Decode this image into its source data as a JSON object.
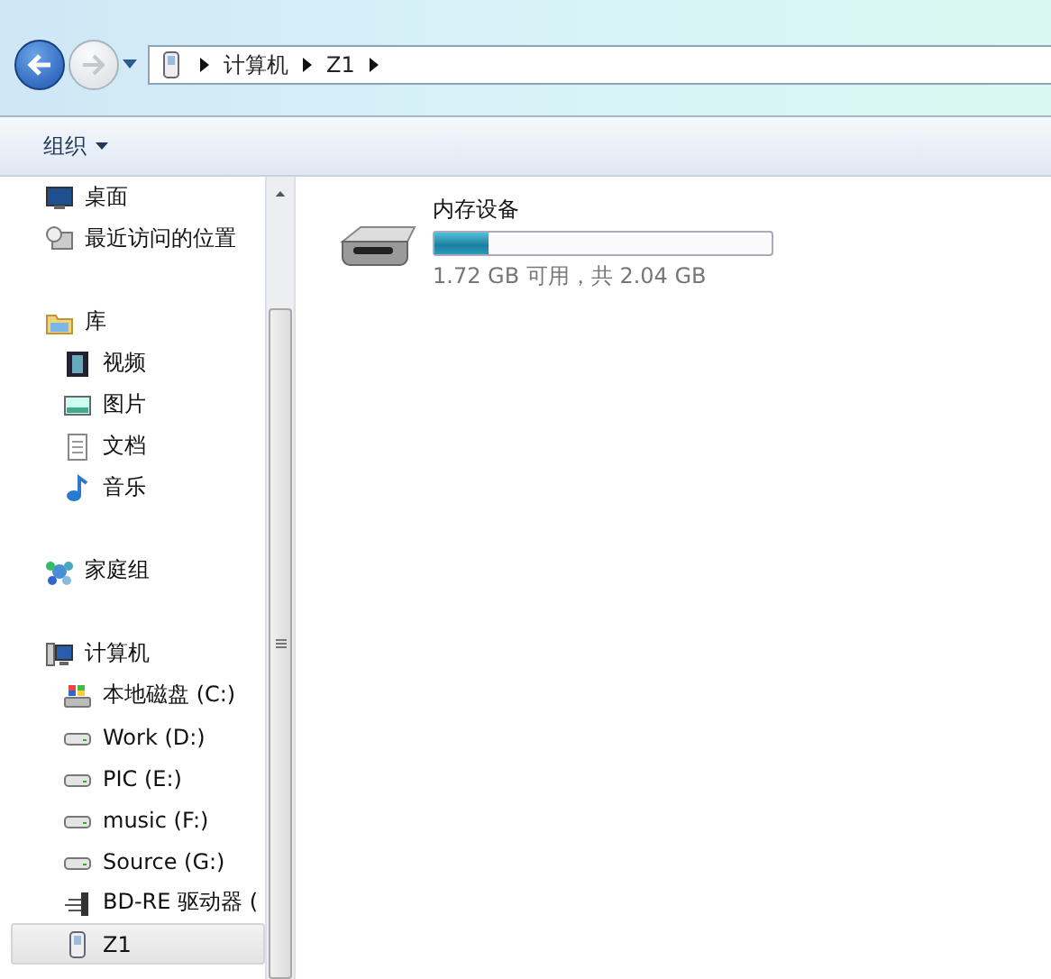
{
  "address_bar": {
    "crumbs": [
      "计算机",
      "Z1"
    ]
  },
  "toolbar": {
    "organize": "组织"
  },
  "nav_pane": {
    "groups": [
      {
        "kind": "favorites",
        "items": [
          {
            "kind": "desktop",
            "label": "桌面",
            "selected": false
          },
          {
            "kind": "recent",
            "label": "最近访问的位置",
            "selected": false
          }
        ]
      },
      {
        "kind": "libraries",
        "label": "库",
        "items": [
          {
            "kind": "video",
            "label": "视频",
            "selected": false
          },
          {
            "kind": "pictures",
            "label": "图片",
            "selected": false
          },
          {
            "kind": "documents",
            "label": "文档",
            "selected": false
          },
          {
            "kind": "music",
            "label": "音乐",
            "selected": false
          }
        ]
      },
      {
        "kind": "homegroup",
        "label": "家庭组"
      },
      {
        "kind": "computer",
        "label": "计算机",
        "items": [
          {
            "kind": "system-drive",
            "label": "本地磁盘 (C:)",
            "selected": false
          },
          {
            "kind": "drive",
            "label": "Work (D:)",
            "selected": false
          },
          {
            "kind": "drive",
            "label": "PIC (E:)",
            "selected": false
          },
          {
            "kind": "drive",
            "label": "music (F:)",
            "selected": false
          },
          {
            "kind": "drive",
            "label": "Source (G:)",
            "selected": false
          },
          {
            "kind": "optical",
            "label": "BD-RE 驱动器 (",
            "selected": false
          },
          {
            "kind": "phone",
            "label": "Z1",
            "selected": true
          }
        ]
      }
    ]
  },
  "content": {
    "devices": [
      {
        "name": "内存设备",
        "level": 0.16,
        "capacity": "1.72 GB 可用，共 2.04 GB"
      }
    ]
  }
}
